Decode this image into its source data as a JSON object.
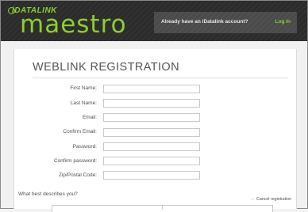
{
  "header": {
    "logo_small": "iDATALINK",
    "logo_main": "maestro",
    "account_prompt": "Already have an iDatalink account?",
    "login_label": "Log In"
  },
  "form": {
    "title": "WEBLINK REGISTRATION",
    "fields": [
      {
        "label": "First Name:",
        "value": ""
      },
      {
        "label": "Last Name:",
        "value": ""
      },
      {
        "label": "Email:",
        "value": ""
      },
      {
        "label": "Confirm Email:",
        "value": ""
      },
      {
        "label": "Password:",
        "value": ""
      },
      {
        "label": "Confirm password:",
        "value": ""
      },
      {
        "label": "Zip/Postal Code:",
        "value": ""
      }
    ],
    "describe_label": "What best describes you?",
    "cancel_label": "Cancel registration"
  },
  "colors": {
    "accent": "#8ccf2e",
    "header_bg": "#2b2b2b",
    "text": "#4f4f4f"
  }
}
